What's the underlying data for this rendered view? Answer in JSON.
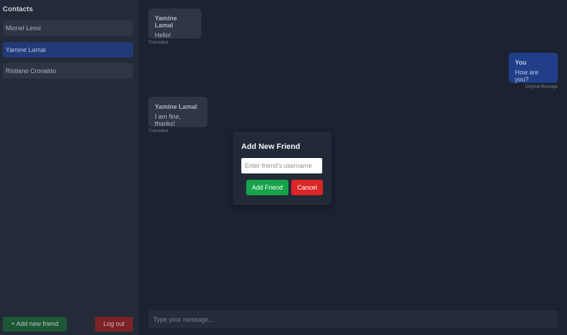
{
  "sidebar": {
    "title": "Contacts",
    "contacts": [
      {
        "name": "Mionel Lessi"
      },
      {
        "name": "Yamine Lamal"
      },
      {
        "name": "Ristiano Cronaldo"
      }
    ],
    "active_contact": "Yamine Lamal",
    "add_friend_label": "+ Add new friend",
    "logout_label": "Log out"
  },
  "chat": {
    "messages": [
      {
        "sender": "Yamine Lamal",
        "text": "Hello!",
        "meta": "Translated"
      },
      {
        "sender": "You",
        "text": "How are you?",
        "meta": "Original Message"
      },
      {
        "sender": "Yamine Lamal",
        "text": "I am fine, thanks!",
        "meta": "Translated"
      }
    ],
    "composer_placeholder": "Type your message..."
  },
  "modal": {
    "title": "Add New Friend",
    "input_placeholder": "Enter friend's username",
    "confirm_label": "Add Friend",
    "cancel_label": "Cancel"
  },
  "colors": {
    "background": "#1b2230",
    "sidebar": "#232b38",
    "active_contact": "#213a78",
    "own_bubble": "#213f88",
    "confirm": "#16a34a",
    "cancel": "#dc2626"
  }
}
